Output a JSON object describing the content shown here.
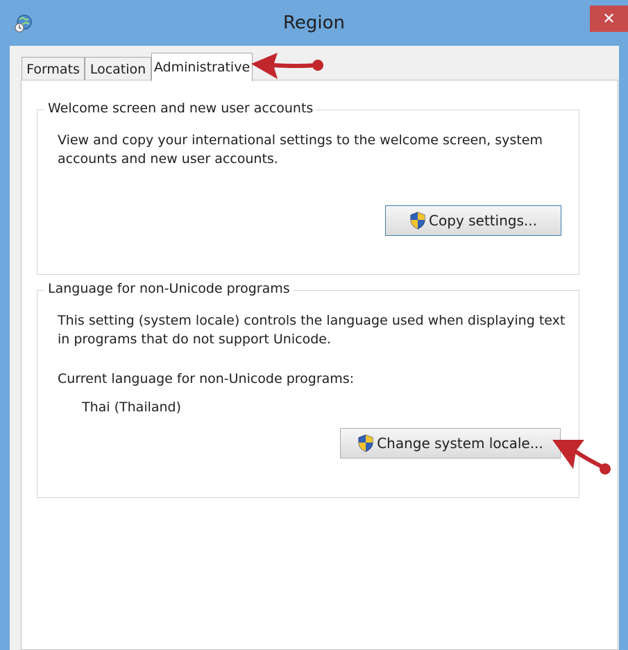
{
  "window": {
    "title": "Region",
    "close_label": "✕"
  },
  "tabs": [
    {
      "label": "Formats"
    },
    {
      "label": "Location"
    },
    {
      "label": "Administrative",
      "active": true
    }
  ],
  "welcome_group": {
    "title": "Welcome screen and new user accounts",
    "description": "View and copy your international settings to the welcome screen, system accounts and new user accounts.",
    "button_label": "Copy settings..."
  },
  "language_group": {
    "title": "Language for non-Unicode programs",
    "description": "This setting (system locale) controls the language used when displaying text in programs that do not support Unicode.",
    "current_label": "Current language for non-Unicode programs:",
    "current_value": "Thai (Thailand)",
    "button_label": "Change system locale..."
  },
  "colors": {
    "titlebar": "#6fa8dc",
    "close": "#c74b4b",
    "annotation_arrow": "#c1272d"
  },
  "icons": [
    "globe-clock-icon",
    "close-icon",
    "uac-shield-icon",
    "annotation-arrow-icon"
  ]
}
